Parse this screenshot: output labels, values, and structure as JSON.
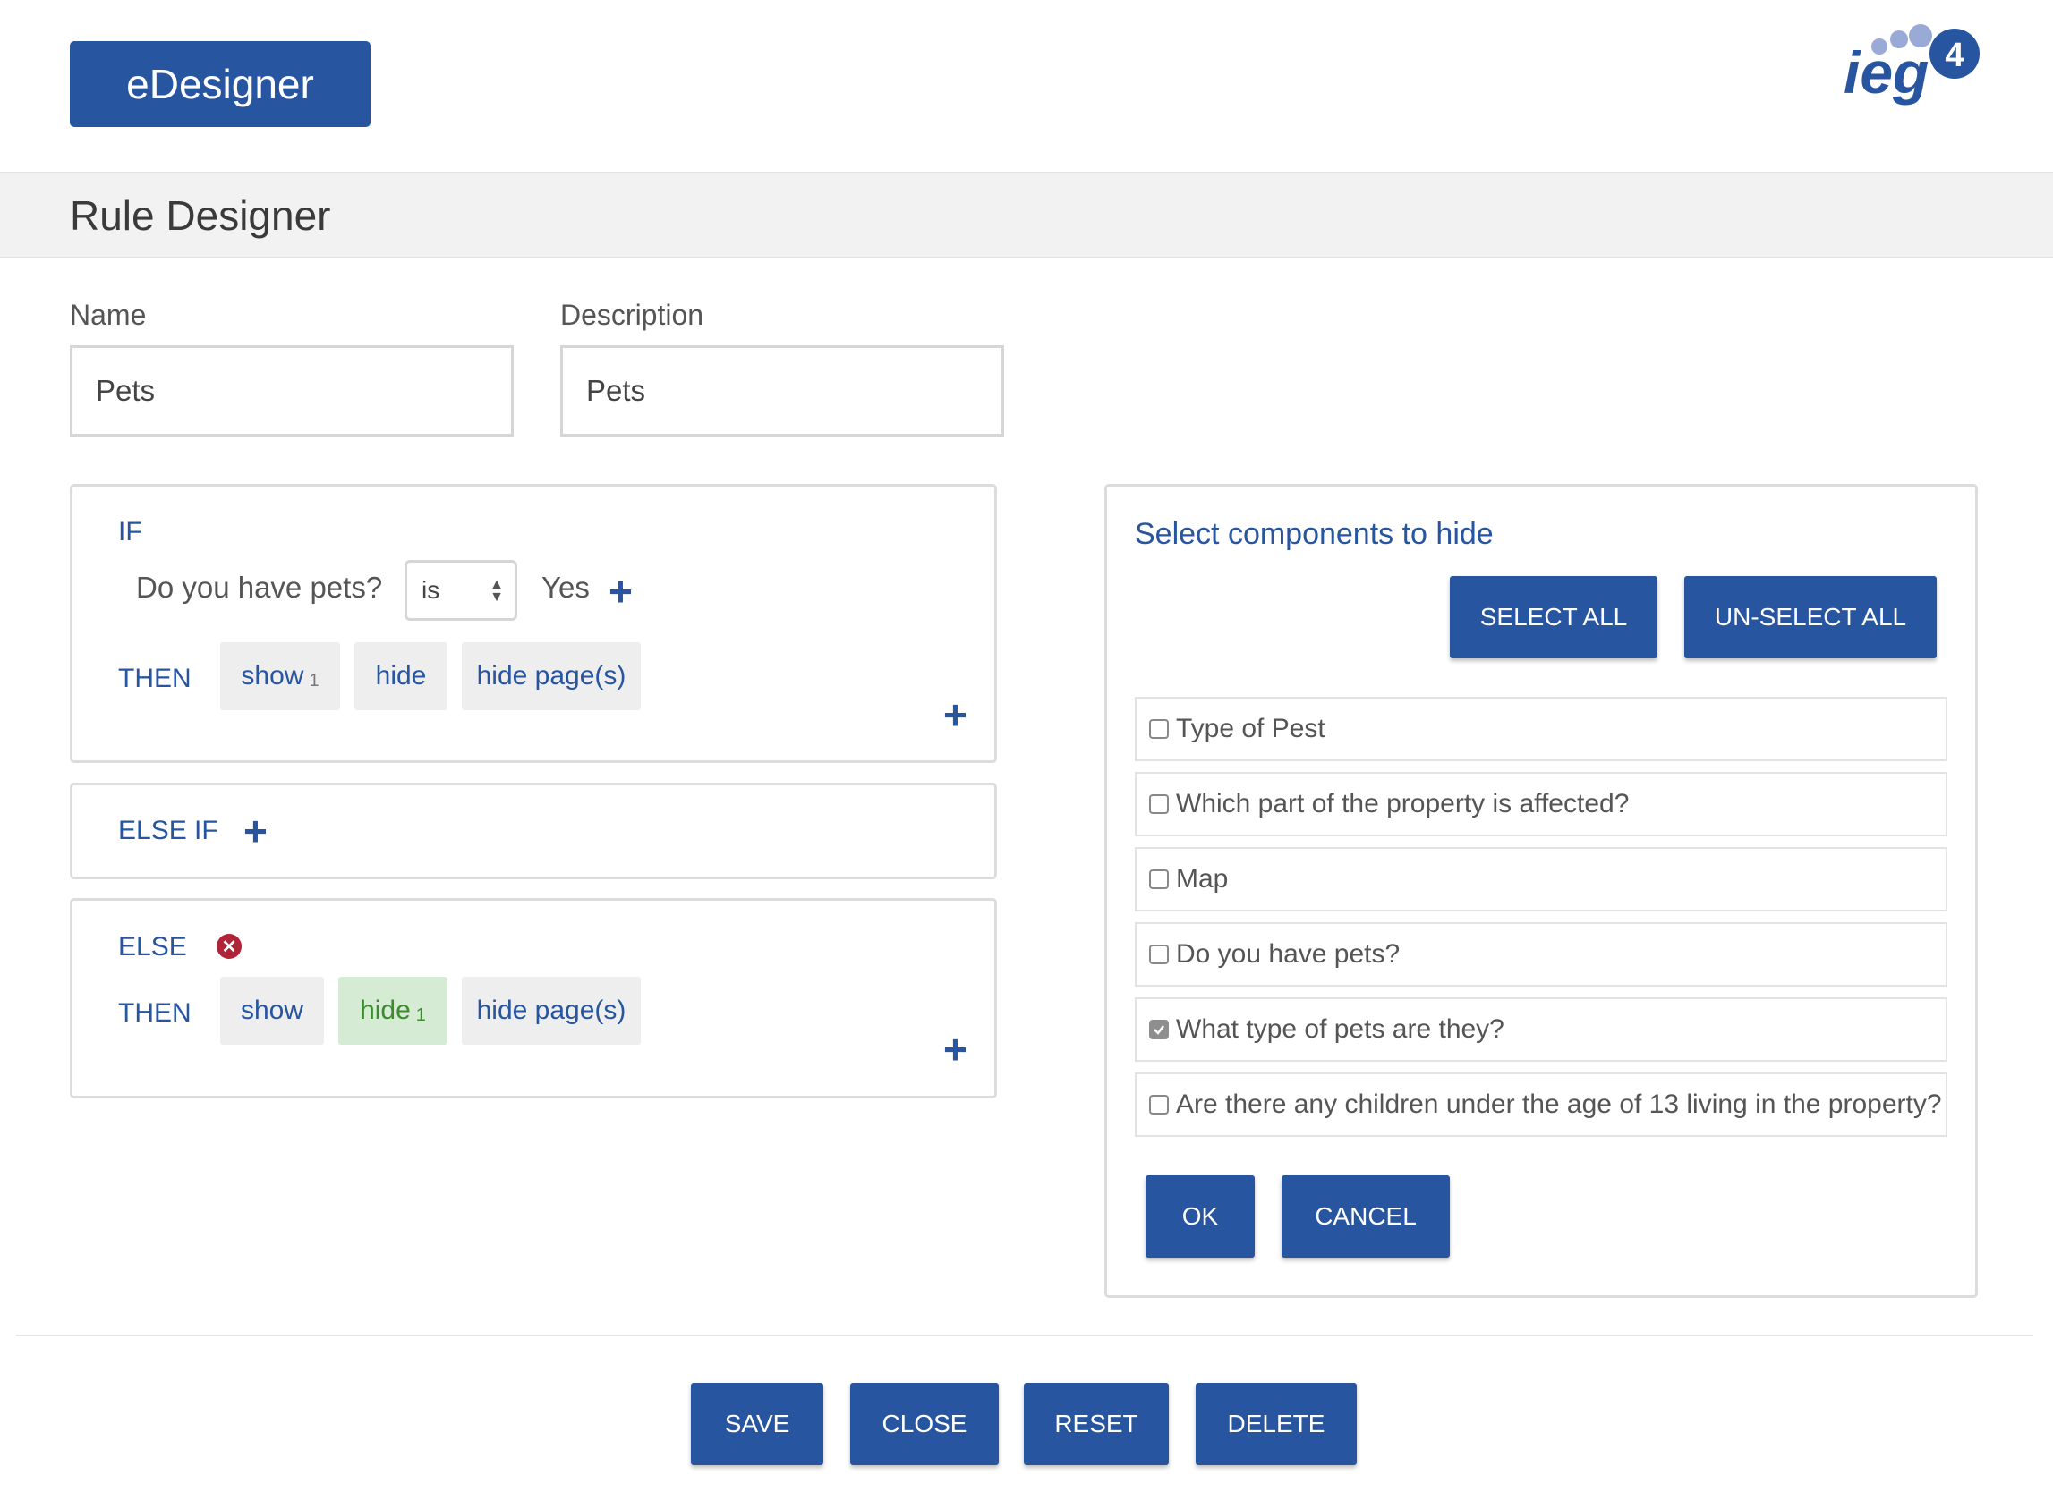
{
  "app": {
    "brand_label": "eDesigner",
    "logo_text": "ieg",
    "logo_badge": "4"
  },
  "page": {
    "title": "Rule Designer"
  },
  "form": {
    "name_label": "Name",
    "name_value": "Pets",
    "description_label": "Description",
    "description_value": "Pets"
  },
  "if_block": {
    "keyword": "IF",
    "question": "Do you have pets?",
    "operator": "is",
    "answer": "Yes",
    "then_keyword": "THEN",
    "actions": [
      {
        "label": "show",
        "count": "1"
      },
      {
        "label": "hide",
        "count": ""
      },
      {
        "label": "hide page(s)",
        "count": ""
      }
    ]
  },
  "else_if_block": {
    "keyword": "ELSE IF"
  },
  "else_block": {
    "keyword": "ELSE",
    "then_keyword": "THEN",
    "actions": [
      {
        "label": "show",
        "count": ""
      },
      {
        "label": "hide",
        "count": "1"
      },
      {
        "label": "hide page(s)",
        "count": ""
      }
    ]
  },
  "picker": {
    "title": "Select components to hide",
    "select_all": "SELECT ALL",
    "unselect_all": "UN-SELECT ALL",
    "items": [
      {
        "label": "Type of Pest",
        "checked": false
      },
      {
        "label": "Which part of the property is affected?",
        "checked": false
      },
      {
        "label": "Map",
        "checked": false
      },
      {
        "label": "Do you have pets?",
        "checked": false
      },
      {
        "label": "What type of pets are they?",
        "checked": true
      },
      {
        "label": "Are there any children under the age of 13 living in the property?",
        "checked": false
      }
    ],
    "ok": "OK",
    "cancel": "CANCEL"
  },
  "footer": {
    "save": "SAVE",
    "close": "CLOSE",
    "reset": "RESET",
    "delete": "DELETE"
  },
  "colors": {
    "primary": "#2855a0",
    "active_chip": "#d6ebd3",
    "active_text": "#3d8a30",
    "danger": "#b0243a"
  }
}
